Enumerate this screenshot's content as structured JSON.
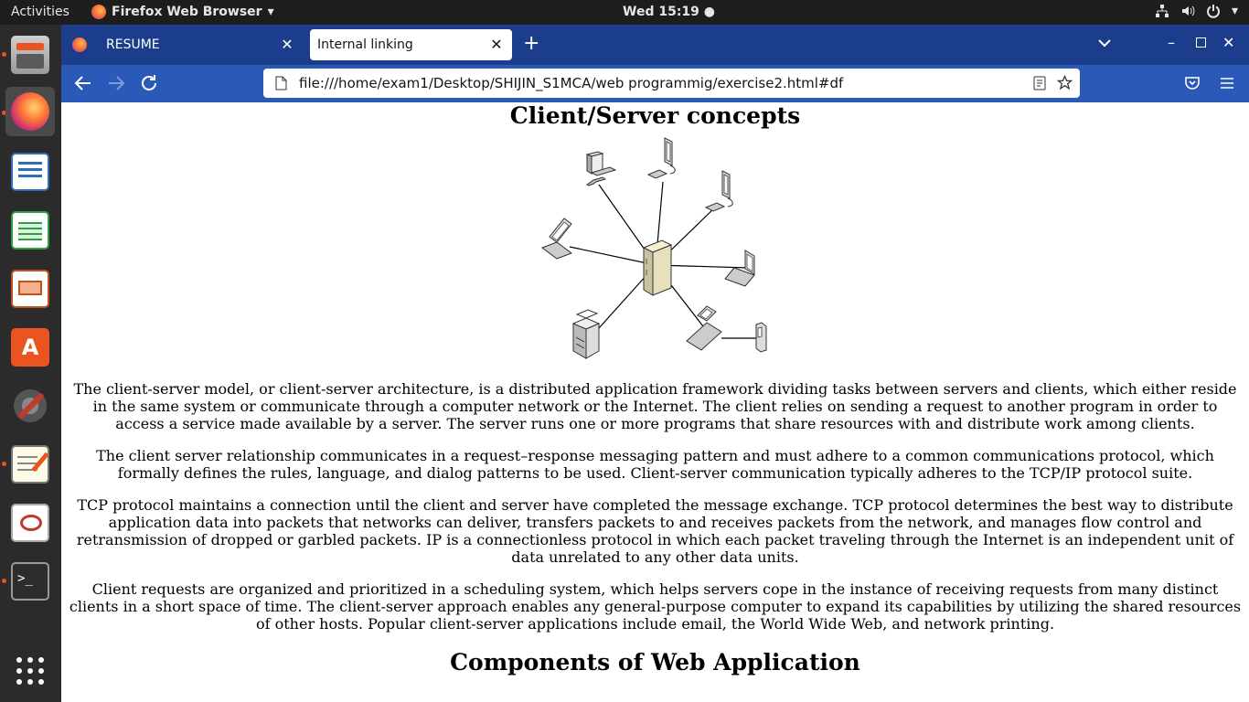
{
  "topbar": {
    "activities": "Activities",
    "app_name": "Firefox Web Browser",
    "clock": "Wed 15:19 ●"
  },
  "dock": {
    "items": [
      "files-icon",
      "firefox-icon",
      "writer-icon",
      "calc-icon",
      "impress-icon",
      "software-icon",
      "settings-icon",
      "text-editor-icon",
      "evince-icon",
      "terminal-icon",
      "app-grid-icon"
    ]
  },
  "browser": {
    "tabs": [
      {
        "label": "RESUME"
      },
      {
        "label": "Internal linking"
      }
    ],
    "url": "file:///home/exam1/Desktop/SHIJIN_S1MCA/web programmig/exercise2.html#df"
  },
  "page": {
    "heading": "Client/Server concepts",
    "paragraphs": [
      "The client-server model, or client-server architecture, is a distributed application framework dividing tasks between servers and clients, which either reside in the same system or communicate through a computer network or the Internet. The client relies on sending a request to another program in order to access a service made available by a server. The server runs one or more programs that share resources with and distribute work among clients.",
      "The client server relationship communicates in a request–response messaging pattern and must adhere to a common communications protocol, which formally defines the rules, language, and dialog patterns to be used. Client-server communication typically adheres to the TCP/IP protocol suite.",
      "TCP protocol maintains a connection until the client and server have completed the message exchange. TCP protocol determines the best way to distribute application data into packets that networks can deliver, transfers packets to and receives packets from the network, and manages flow control and retransmission of dropped or garbled packets. IP is a connectionless protocol in which each packet traveling through the Internet is an independent unit of data unrelated to any other data units.",
      "Client requests are organized and prioritized in a scheduling system, which helps servers cope in the instance of receiving requests from many distinct clients in a short space of time. The client-server approach enables any general-purpose computer to expand its capabilities by utilizing the shared resources of other hosts. Popular client-server applications include email, the World Wide Web, and network printing."
    ],
    "heading2": "Components of Web Application"
  }
}
